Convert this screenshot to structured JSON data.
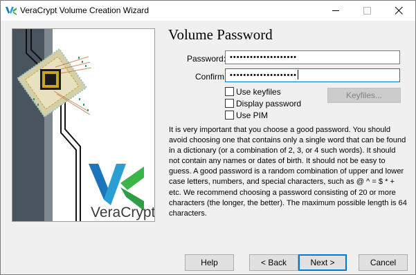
{
  "window": {
    "title": "VeraCrypt Volume Creation Wizard",
    "icon": "veracrypt-vc-icon"
  },
  "banner": {
    "logo_text": "VeraCrypt",
    "logo_mark": "VC"
  },
  "page": {
    "heading": "Volume Password"
  },
  "form": {
    "password_label": "Password:",
    "password_value": "••••••••••••••••••••",
    "confirm_label": "Confirm:",
    "confirm_value": "••••••••••••••••••••",
    "use_keyfiles_label": "Use keyfiles",
    "use_keyfiles_checked": false,
    "display_password_label": "Display password",
    "display_password_checked": false,
    "use_pim_label": "Use PIM",
    "use_pim_checked": false,
    "keyfiles_button": "Keyfiles..."
  },
  "info_text": "It is very important that you choose a good password. You should avoid choosing one that contains only a single word that can be found in a dictionary (or a combination of 2, 3, or 4 such words). It should not contain any names or dates of birth. It should not be easy to guess. A good password is a random combination of upper and lower case letters, numbers, and special characters, such as @ ^ = $ * + etc. We recommend choosing a password consisting of 20 or more characters (the longer, the better). The maximum possible length is 64 characters.",
  "buttons": {
    "help": "Help",
    "back": "< Back",
    "next": "Next >",
    "cancel": "Cancel"
  },
  "colors": {
    "focus_blue": "#0078d7",
    "logo_blue": "#1b75bb",
    "logo_green": "#39b54a",
    "chip_gold": "#c9a227"
  }
}
